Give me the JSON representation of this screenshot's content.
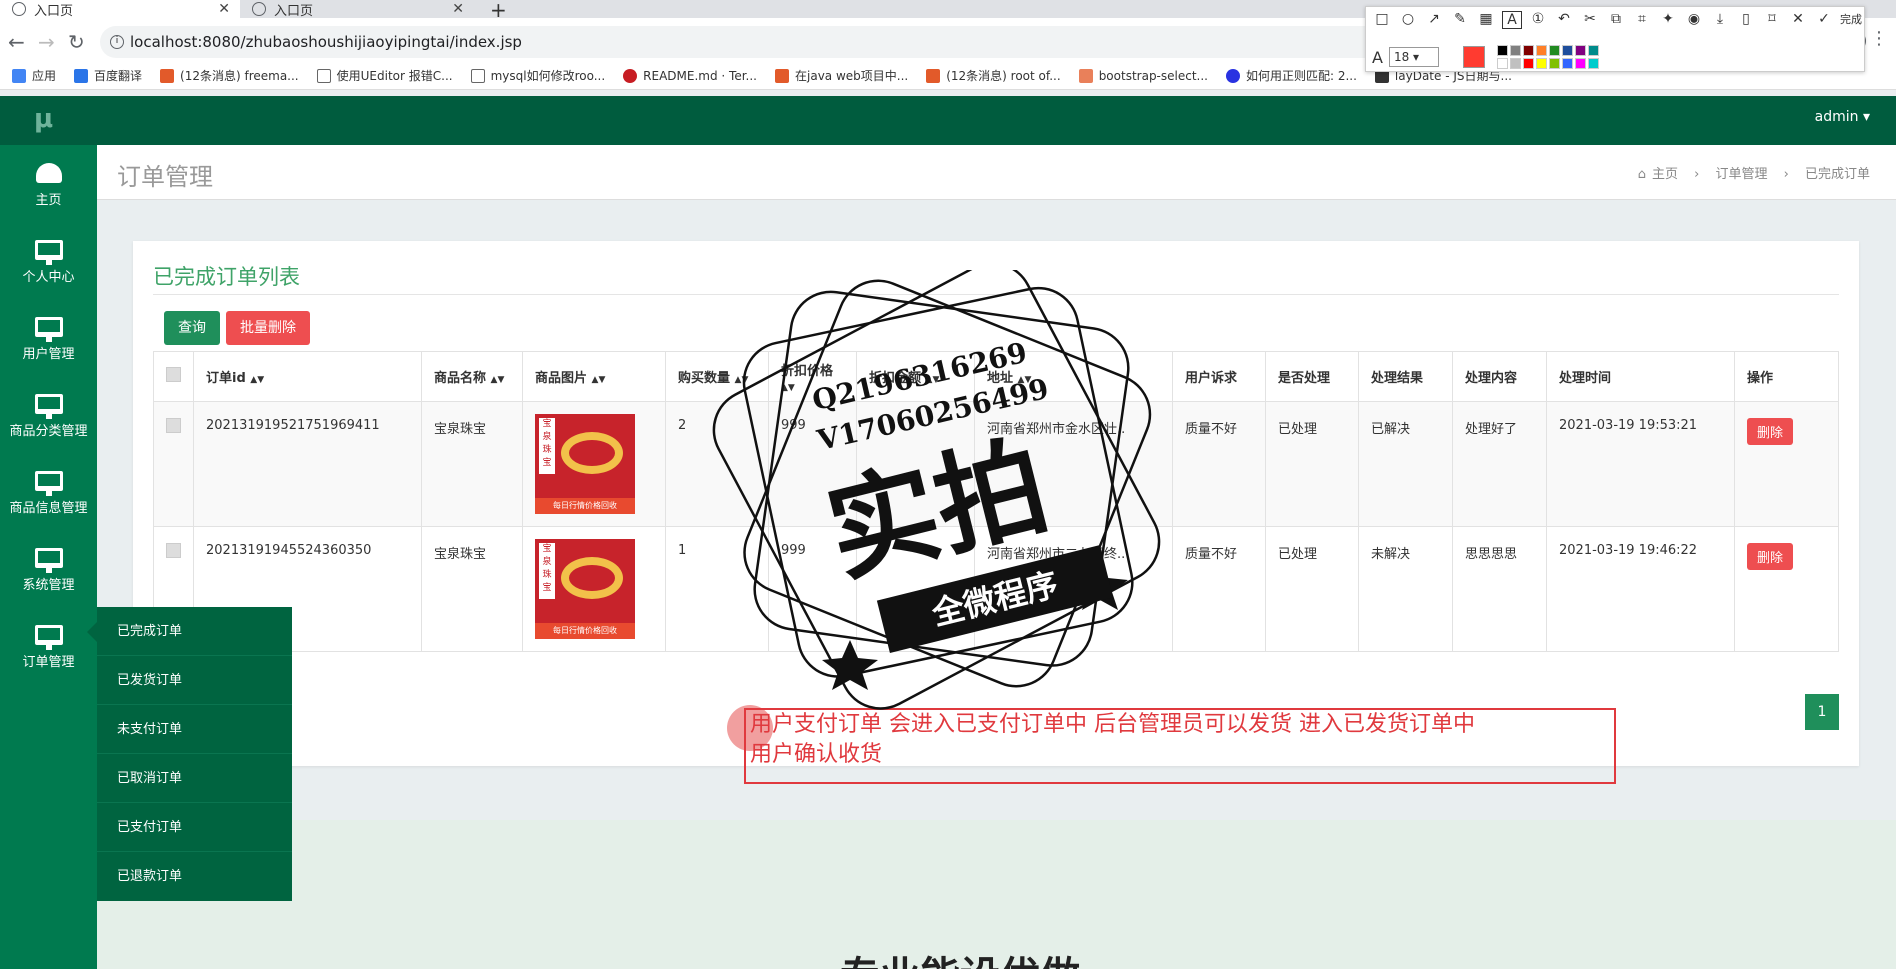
{
  "browser": {
    "tabs": [
      {
        "label": "入口页"
      },
      {
        "label": "入口页"
      }
    ],
    "url": "localhost:8080/zhubaoshoushijiaoyipingtai/index.jsp",
    "bookmarks": [
      {
        "label": "应用"
      },
      {
        "label": "百度翻译"
      },
      {
        "label": "(12条消息) freema..."
      },
      {
        "label": "使用UEditor 报错C..."
      },
      {
        "label": "mysql如何修改roo..."
      },
      {
        "label": "README.md · Ter..."
      },
      {
        "label": "在java web项目中..."
      },
      {
        "label": "(12条消息) root of..."
      },
      {
        "label": "bootstrap-select..."
      },
      {
        "label": "如何用正则匹配: 2..."
      },
      {
        "label": "layDate - JS日期与..."
      }
    ]
  },
  "annotation_toolbar": {
    "done_label": "完成",
    "font_size": "18",
    "active_color": "#ff3b30",
    "palette": [
      "#000000",
      "#808080",
      "#800000",
      "#ff7f27",
      "#228b22",
      "#1f4e9c",
      "#800080",
      "#008b8b",
      "#ffffff",
      "#c0c0c0",
      "#ff0000",
      "#ffff00",
      "#80c000",
      "#3366ff",
      "#ff00ff",
      "#00cccc"
    ]
  },
  "app": {
    "logo": "μ",
    "user": "admin ▾",
    "sidebar": [
      {
        "label": "主页",
        "icon": "dashboard-icon"
      },
      {
        "label": "个人中心",
        "icon": "monitor-icon"
      },
      {
        "label": "用户管理",
        "icon": "monitor-icon"
      },
      {
        "label": "商品分类管理",
        "icon": "monitor-icon"
      },
      {
        "label": "商品信息管理",
        "icon": "monitor-icon"
      },
      {
        "label": "系统管理",
        "icon": "monitor-icon"
      },
      {
        "label": "订单管理",
        "icon": "monitor-icon"
      }
    ],
    "submenu": [
      {
        "label": "已完成订单"
      },
      {
        "label": "已发货订单"
      },
      {
        "label": "未支付订单"
      },
      {
        "label": "已取消订单"
      },
      {
        "label": "已支付订单"
      },
      {
        "label": "已退款订单"
      }
    ],
    "page_title": "订单管理",
    "breadcrumb": {
      "home": "主页",
      "section": "订单管理",
      "current": "已完成订单"
    },
    "panel_title": "已完成订单列表",
    "buttons": {
      "query": "查询",
      "batch_delete": "批量删除",
      "delete": "删除"
    },
    "table": {
      "headers": [
        "订单id",
        "商品名称",
        "商品图片",
        "购买数量",
        "折扣价格",
        "折扣金额",
        "地址",
        "用户诉求",
        "是否处理",
        "处理结果",
        "处理内容",
        "处理时间",
        "操作"
      ],
      "rows": [
        {
          "id": "20213191952175196941​1",
          "name": "宝泉珠宝",
          "qty": "2",
          "price": "999",
          "amount": "",
          "address": "河南省郑州市金水区壮..",
          "appeal": "质量不好",
          "handled": "已处理",
          "result": "已解决",
          "content": "处理好了",
          "time": "2021-03-19 19:53:21"
        },
        {
          "id": "20213191945524360350",
          "name": "宝泉珠宝",
          "qty": "1",
          "price": "999",
          "amount": "",
          "address": "河南省郑州市二七区终..",
          "appeal": "质量不好",
          "handled": "已处理",
          "result": "未解决",
          "content": "思思思思",
          "time": "2021-03-19 19:46:22"
        }
      ]
    },
    "product_image_text": {
      "bar": "每日行情价格回收",
      "tag": "宝泉珠宝"
    },
    "page_number": "1",
    "bottom_heading": "专业能设优做"
  },
  "overlay": {
    "note_line1": "用户支付订单 会进入已支付订单中  后台管理员可以发货 进入已发货订单中",
    "note_line2": "用户确认收货",
    "stamp_qq": "Q2196316269",
    "stamp_v": "V17060256499",
    "stamp_big": "实拍",
    "stamp_banner": "全微程序"
  }
}
